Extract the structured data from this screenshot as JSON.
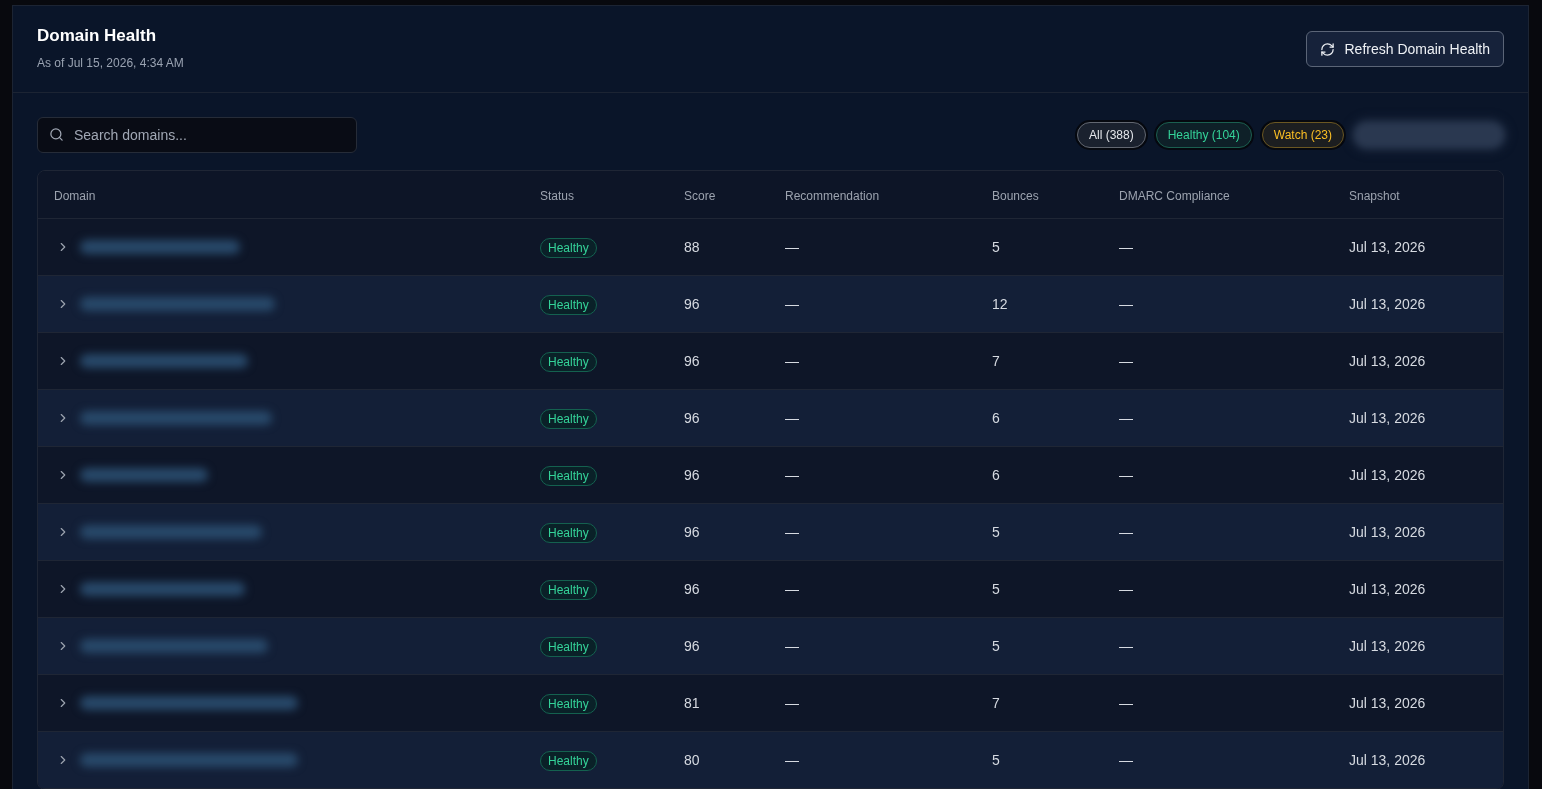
{
  "panel": {
    "title": "Domain Health",
    "subtitle": "As of Jul 15, 2026, 4:34 AM",
    "refresh_button": "Refresh Domain Health"
  },
  "search": {
    "placeholder": "Search domains..."
  },
  "filters": [
    {
      "kind": "chip",
      "label": "All (388)",
      "color": "#e5e7eb"
    },
    {
      "kind": "chip",
      "label": "Healthy (104)",
      "color": "#34d399"
    },
    {
      "kind": "chip",
      "label": "Watch (23)",
      "color": "#fbbf24"
    },
    {
      "kind": "blurred"
    }
  ],
  "table": {
    "columns": [
      "Domain",
      "Status",
      "Score",
      "Recommendation",
      "Bounces",
      "DMARC Compliance",
      "Snapshot"
    ],
    "rows": [
      {
        "expanded": false,
        "status": "Healthy",
        "score": "88",
        "recommendation": "—",
        "bounces": "5",
        "dmarc": "—",
        "snapshot": "Jul 13, 2026"
      },
      {
        "expanded": false,
        "status": "Healthy",
        "score": "96",
        "recommendation": "—",
        "bounces": "12",
        "dmarc": "—",
        "snapshot": "Jul 13, 2026"
      },
      {
        "expanded": false,
        "status": "Healthy",
        "score": "96",
        "recommendation": "—",
        "bounces": "7",
        "dmarc": "—",
        "snapshot": "Jul 13, 2026"
      },
      {
        "expanded": false,
        "status": "Healthy",
        "score": "96",
        "recommendation": "—",
        "bounces": "6",
        "dmarc": "—",
        "snapshot": "Jul 13, 2026"
      },
      {
        "expanded": false,
        "status": "Healthy",
        "score": "96",
        "recommendation": "—",
        "bounces": "6",
        "dmarc": "—",
        "snapshot": "Jul 13, 2026"
      },
      {
        "expanded": false,
        "status": "Healthy",
        "score": "96",
        "recommendation": "—",
        "bounces": "5",
        "dmarc": "—",
        "snapshot": "Jul 13, 2026"
      },
      {
        "expanded": false,
        "status": "Healthy",
        "score": "96",
        "recommendation": "—",
        "bounces": "5",
        "dmarc": "—",
        "snapshot": "Jul 13, 2026"
      },
      {
        "expanded": false,
        "status": "Healthy",
        "score": "96",
        "recommendation": "—",
        "bounces": "5",
        "dmarc": "—",
        "snapshot": "Jul 13, 2026"
      },
      {
        "expanded": false,
        "status": "Healthy",
        "score": "81",
        "recommendation": "—",
        "bounces": "7",
        "dmarc": "—",
        "snapshot": "Jul 13, 2026"
      },
      {
        "expanded": false,
        "status": "Healthy",
        "score": "80",
        "recommendation": "—",
        "bounces": "5",
        "dmarc": "—",
        "snapshot": "Jul 13, 2026"
      }
    ]
  }
}
